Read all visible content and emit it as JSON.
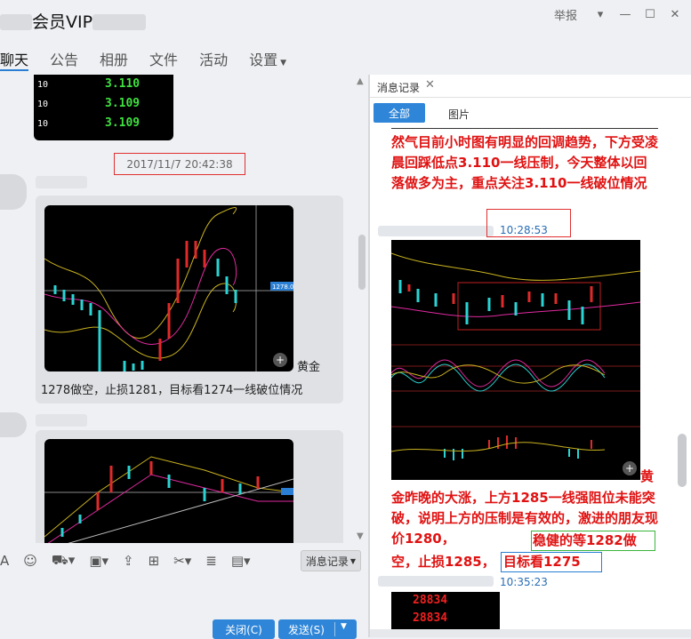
{
  "window": {
    "title": "会员VIP",
    "report": "举报",
    "controls": [
      "▾",
      "—",
      "☐",
      "✕"
    ]
  },
  "tabs": [
    "聊天",
    "公告",
    "相册",
    "文件",
    "活动",
    "设置"
  ],
  "chat": {
    "ticker_rows": [
      {
        "num": "10",
        "value": "3.110"
      },
      {
        "num": "10",
        "value": "3.109"
      },
      {
        "num": "10",
        "value": "3.109"
      }
    ],
    "timestamp": "2017/11/7 20:42:38",
    "message1": {
      "suffix": "黄金",
      "text": "1278做空，止损1281，目标看1274一线破位情况",
      "chart_price_tag": "1278.0"
    }
  },
  "toolbar": {
    "history_button": "消息记录"
  },
  "buttons": {
    "close": "关闭(C)",
    "send": "发送(S)"
  },
  "panel": {
    "tab_label": "消息记录",
    "filter_all": "全部",
    "filter_images": "图片",
    "msg1_text": "然气目前小时图有明显的回调趋势，下方受凌晨回踩低点3.110一线压制，今天整体以回落做多为主，重点关注3.110一线破位情况",
    "msg1_time": "10:28:53",
    "msg2_text_a": "黄",
    "msg2_text_b": "金昨晚的大涨，上方1285一线强阻位未能突破，说明上方的压制是有效的，激进的朋友现价1280，",
    "msg2_text_green": "稳健的等1282做",
    "msg2_text_c": "空，止损1285，",
    "msg2_text_blue": "目标看1275",
    "msg2_time": "10:35:23",
    "ticker_values": [
      "28834",
      "28834"
    ]
  }
}
